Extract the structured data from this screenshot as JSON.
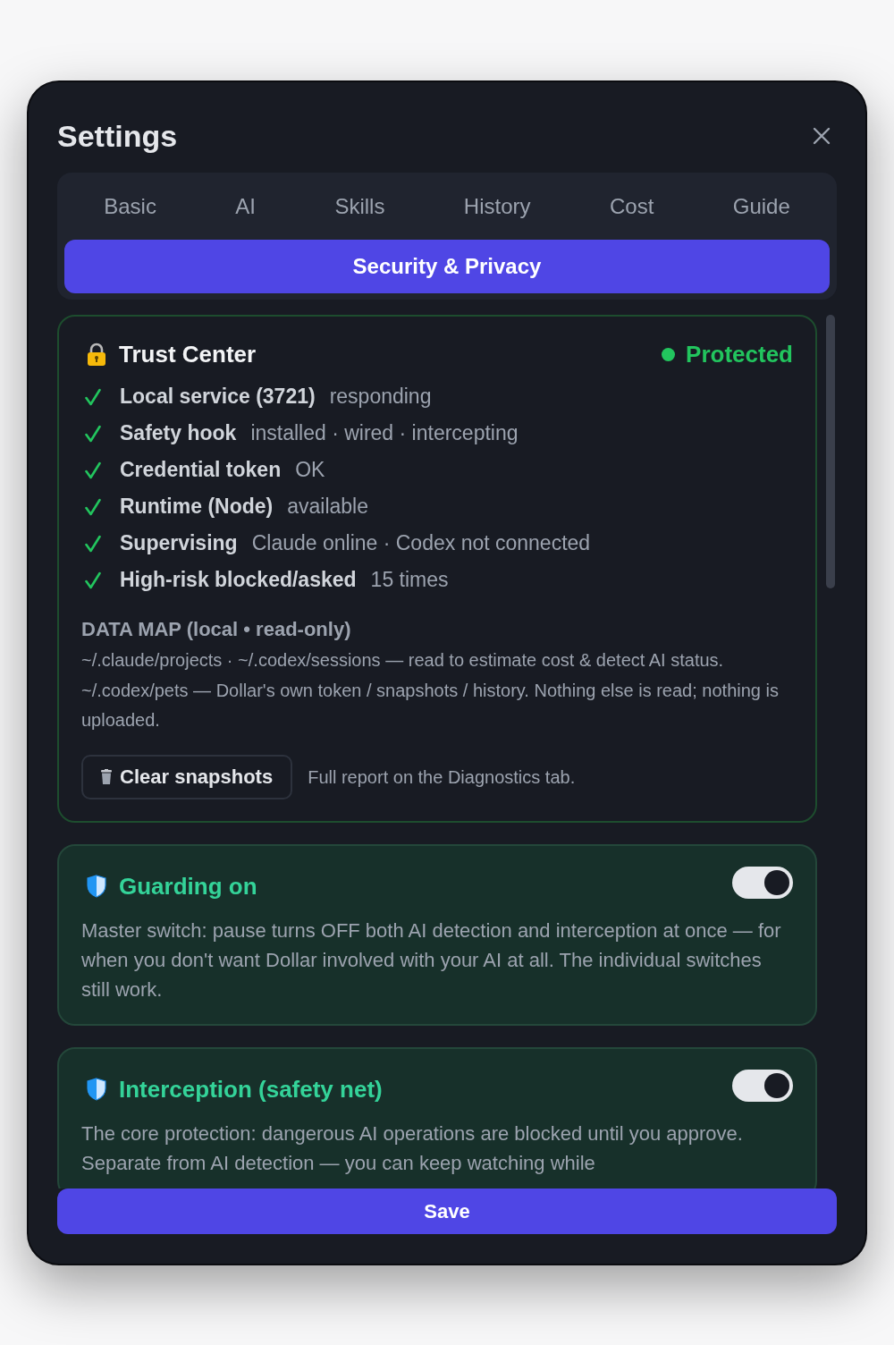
{
  "window": {
    "title": "Settings"
  },
  "tabs": [
    {
      "label": "Basic",
      "selected": false
    },
    {
      "label": "AI",
      "selected": false
    },
    {
      "label": "Skills",
      "selected": false
    },
    {
      "label": "History",
      "selected": false
    },
    {
      "label": "Cost",
      "selected": false
    },
    {
      "label": "Guide",
      "selected": false
    },
    {
      "label": "Security & Privacy",
      "selected": true
    }
  ],
  "trust_center": {
    "title": "Trust Center",
    "status": "Protected",
    "checks": [
      {
        "label": "Local service (3721)",
        "value": "responding",
        "ok": true
      },
      {
        "label": "Safety hook",
        "value": "installed · wired · intercepting",
        "ok": true
      },
      {
        "label": "Credential token",
        "value": "OK",
        "ok": true
      },
      {
        "label": "Runtime (Node)",
        "value": "available",
        "ok": true
      },
      {
        "label": "Supervising",
        "value": "Claude online · Codex not connected",
        "ok": true
      },
      {
        "label": "High-risk blocked/asked",
        "value": "15 times",
        "ok": true
      }
    ],
    "data_map": {
      "heading": "DATA MAP (local • read-only)",
      "text": "~/.claude/projects · ~/.codex/sessions — read to estimate cost & detect AI status. ~/.codex/pets — Dollar's own token / snapshots / history. Nothing else is read; nothing is uploaded."
    },
    "clear_button": "Clear snapshots",
    "note": "Full report on the Diagnostics tab."
  },
  "switches": [
    {
      "title": "Guarding on",
      "description": "Master switch: pause turns OFF both AI detection and interception at once — for when you don't want Dollar involved with your AI at all. The individual switches still work.",
      "on": true
    },
    {
      "title": "Interception (safety net)",
      "description": "The core protection: dangerous AI operations are blocked until you approve. Separate from AI detection — you can keep watching while",
      "on": true
    }
  ],
  "save_button": "Save"
}
